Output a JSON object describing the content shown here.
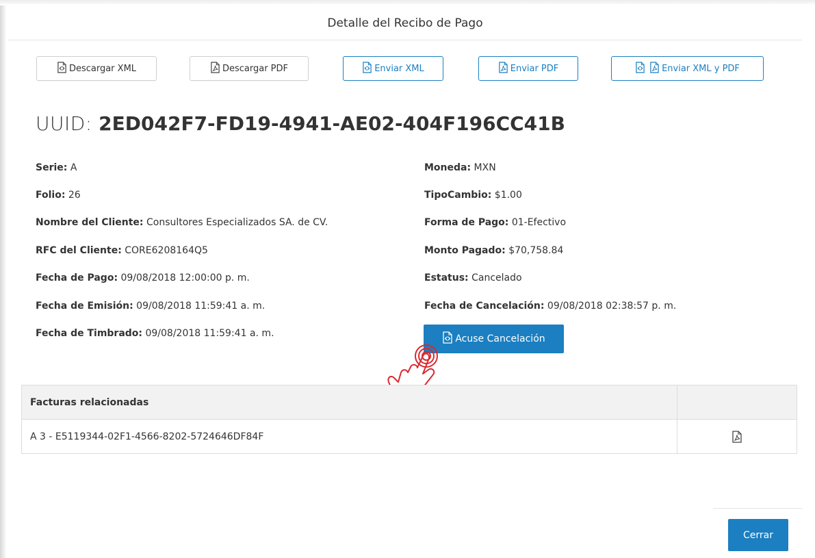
{
  "dialog": {
    "title": "Detalle del Recibo de Pago"
  },
  "toolbar": {
    "download_xml": "Descargar XML",
    "download_pdf": "Descargar PDF",
    "send_xml": "Enviar XML",
    "send_pdf": "Enviar PDF",
    "send_xml_pdf": "Enviar XML y PDF"
  },
  "uuid": {
    "label": "UUID: ",
    "value": "2ED042F7-FD19-4941-AE02-404F196CC41B"
  },
  "details_left": [
    {
      "label": "Serie:",
      "value": " A"
    },
    {
      "label": "Folio:",
      "value": " 26"
    },
    {
      "label": "Nombre del Cliente:",
      "value": " Consultores Especializados SA. de CV."
    },
    {
      "label": "RFC del Cliente:",
      "value": " CORE6208164Q5"
    },
    {
      "label": "Fecha de Pago:",
      "value": " 09/08/2018 12:00:00 p. m."
    },
    {
      "label": "Fecha de Emisión:",
      "value": " 09/08/2018 11:59:41 a. m."
    },
    {
      "label": "Fecha de Timbrado:",
      "value": " 09/08/2018 11:59:41 a. m."
    }
  ],
  "details_right": [
    {
      "label": "Moneda:",
      "value": " MXN"
    },
    {
      "label": "TipoCambio:",
      "value": " $1.00"
    },
    {
      "label": "Forma de Pago:",
      "value": " 01-Efectivo"
    },
    {
      "label": "Monto Pagado:",
      "value": " $70,758.84"
    },
    {
      "label": "Estatus:",
      "value": " Cancelado"
    },
    {
      "label": "Fecha de Cancelación:",
      "value": " 09/08/2018 02:38:57 p. m."
    }
  ],
  "acuse_button": "Acuse Cancelación",
  "related_table": {
    "header": "Facturas relacionadas",
    "rows": [
      {
        "text": "A 3 - E5119344-02F1-4566-8202-5724646DF84F"
      }
    ]
  },
  "footer": {
    "close_label": "Cerrar"
  },
  "colors": {
    "primary": "#1b7fc1",
    "hand_outline": "#d9282f"
  },
  "icons": {
    "xml": "xml-file-icon",
    "pdf": "pdf-file-icon",
    "pointer": "pointing-hand-icon"
  }
}
